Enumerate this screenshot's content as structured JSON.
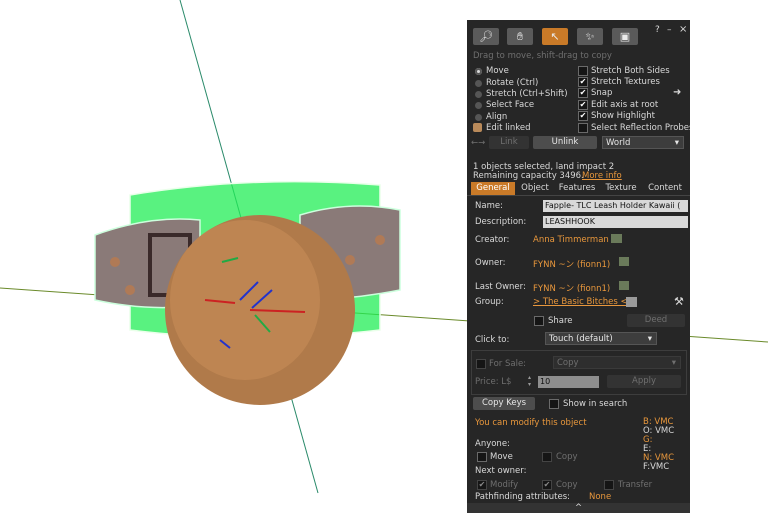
{
  "toolbar": {
    "icons": [
      "magnifier-icon",
      "hand-icon",
      "arrow-icon",
      "wand-icon",
      "bulldozer-icon"
    ],
    "help": "?",
    "minimize": "–",
    "close": "×",
    "hint": "Drag to move, shift-drag to copy"
  },
  "modes": [
    "Move",
    "Rotate (Ctrl)",
    "Stretch (Ctrl+Shift)",
    "Select Face",
    "Align"
  ],
  "edit_linked": "Edit linked",
  "options": [
    "Stretch Both Sides",
    "Stretch Textures",
    "Snap",
    "Edit axis at root",
    "Show Highlight",
    "Select Reflection Probes"
  ],
  "options_checked": [
    false,
    true,
    true,
    true,
    true,
    false
  ],
  "link": {
    "link_label": "Link",
    "unlink_label": "Unlink",
    "ref_frame": "World",
    "link_arrows": "←→"
  },
  "status": {
    "selected": "1 objects selected, land impact 2",
    "capacity": "Remaining capacity 3496.",
    "more_info": "More info"
  },
  "tabs": [
    "General",
    "Object",
    "Features",
    "Texture",
    "Content"
  ],
  "general": {
    "name_label": "Name:",
    "name_value": "Fapple- TLC Leash Holder Kawaii (",
    "desc_label": "Description:",
    "desc_value": "LEASHHOOK",
    "creator_label": "Creator:",
    "creator_value": "Anna Timmerman",
    "owner_label": "Owner:",
    "owner_value": "FYNN ~ン (fionn1)",
    "last_owner_label": "Last Owner:",
    "last_owner_value": "FYNN ~ン (fionn1)",
    "group_label": "Group:",
    "group_value": "> The Basic Bitches <",
    "share_label": "Share",
    "deed_label": "Deed",
    "click_to_label": "Click to:",
    "click_to_value": "Touch  (default)",
    "for_sale_label": "For Sale:",
    "copy_option": "Copy",
    "price_label": "Price: L$",
    "price_value": "10",
    "apply_label": "Apply",
    "copy_keys_label": "Copy Keys",
    "show_in_search_label": "Show in search",
    "modify_notice": "You can modify this object",
    "perms": [
      "B: VMC",
      "O: VMC",
      "G:",
      "E:",
      "N: VMC",
      "F:VMC"
    ],
    "anyone_label": "Anyone:",
    "anyone_move": "Move",
    "anyone_copy": "Copy",
    "next_owner_label": "Next owner:",
    "next_modify": "Modify",
    "next_copy": "Copy",
    "next_transfer": "Transfer",
    "pathfinding_label": "Pathfinding attributes:",
    "pathfinding_value": "None",
    "expand": "^"
  },
  "colors": {
    "accent": "#c97a28",
    "panel": "#262626",
    "link_orange": "#e8973c",
    "selection_green": "#22ff44"
  }
}
